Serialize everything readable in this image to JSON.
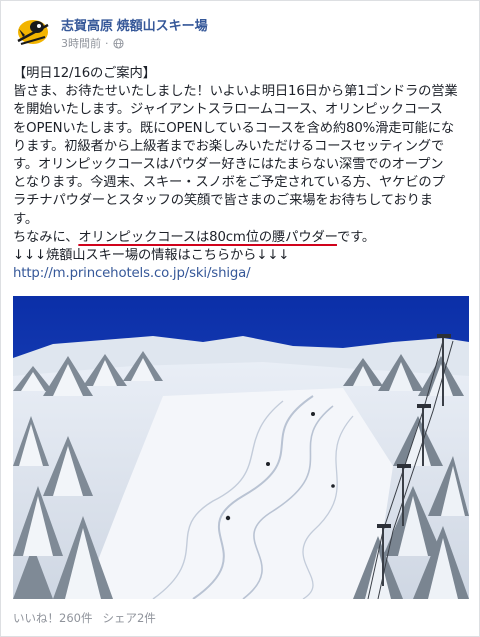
{
  "post": {
    "page_name": "志賀高原 焼額山スキー場",
    "timestamp": "3時間前",
    "separator": "·",
    "privacy_icon": "globe-icon",
    "lines": {
      "l1": "【明日12/16のご案内】",
      "l2": "皆さま、お待たせいたしました！いよいよ明日16日から第1ゴンドラの営業",
      "l3": "を開始いたします。ジャイアントスラロームコース、オリンピックコース",
      "l4": "をOPENいたします。既にOPENしているコースを含め約80%滑走可能にな",
      "l5": "ります。初級者から上級者までお楽しみいただけるコースセッティングで",
      "l6": "す。オリンピックコースはパウダー好きにはたまらない深雪でのオープン",
      "l7": "となります。今週末、スキー・スノボをご予定されている方、ヤケビのプ",
      "l8": "ラチナパウダーとスタッフの笑顔で皆さまのご来場をお待ちしておりま",
      "l9": "す。",
      "l10_pre": "ちなみに、",
      "l10_underline": "オリンピックコースは80cm位の腰パウダー",
      "l10_post": "です。",
      "l11": "↓↓↓焼額山スキー場の情報はこちらから↓↓↓",
      "link": "http://m.princehotels.co.jp/ski/shiga/"
    },
    "accent_underline_color": "#d0021b"
  },
  "footer": {
    "likes": "いいね！260件",
    "shares": "シェア2件"
  }
}
